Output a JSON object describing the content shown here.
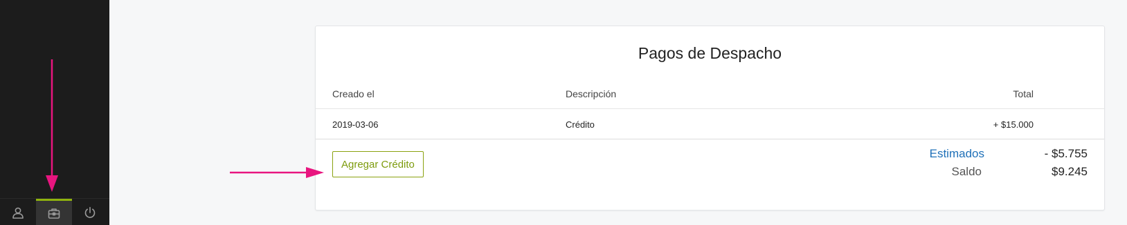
{
  "sidebar": {
    "items": [
      {
        "icon": "user-icon"
      },
      {
        "icon": "briefcase-icon",
        "active": true
      },
      {
        "icon": "power-icon"
      }
    ],
    "active_color": "#8fb30e"
  },
  "card": {
    "title": "Pagos de Despacho",
    "columns": {
      "date": "Creado el",
      "description": "Descripción",
      "total": "Total"
    },
    "rows": [
      {
        "date": "2019-03-06",
        "description": "Crédito",
        "total": "+ $15.000"
      }
    ],
    "add_button": "Agregar Crédito",
    "summary": {
      "estimated_label": "Estimados",
      "estimated_value": "- $5.755",
      "balance_label": "Saldo",
      "balance_value": "$9.245"
    }
  },
  "annotations": {
    "arrow_color": "#e8157f"
  }
}
